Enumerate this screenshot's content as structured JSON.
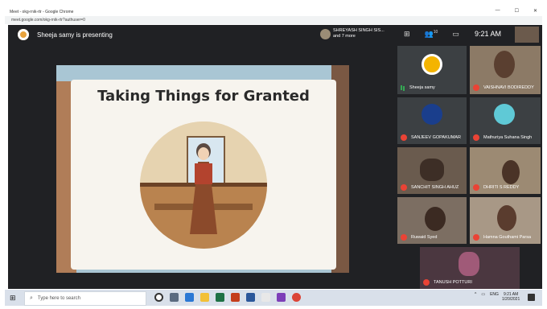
{
  "browser": {
    "title": "Meet - okg-rnik-rtr - Google Chrome",
    "url": "meet.google.com/okg-rnik-rtr?authuser=0",
    "controls": [
      "—",
      "☐",
      "✕"
    ]
  },
  "meet": {
    "presenter_text": "Sheeja samy is presenting",
    "shreyash_line1": "SHREYASH SINGH SIS...",
    "shreyash_line2": "and 7 more",
    "clock": "9:21 AM",
    "participants_count": "10",
    "icons": [
      "layout-icon",
      "people-icon",
      "chat-icon"
    ]
  },
  "slide": {
    "title": "Taking Things for Granted"
  },
  "participants": [
    {
      "name": "Sheeja samy",
      "muted": false
    },
    {
      "name": "VAISHNAVI BODIREDDY",
      "muted": true
    },
    {
      "name": "SANJEEV GOPAKUMAR",
      "muted": true
    },
    {
      "name": "Mathuriya Suhana Singh",
      "muted": true
    },
    {
      "name": "SANCHIT SINGH AHUZ",
      "muted": true
    },
    {
      "name": "DHRITI S REDDY",
      "muted": true
    },
    {
      "name": "Ruwaid Syed",
      "muted": true
    },
    {
      "name": "Hamna Gouthami Parsa",
      "muted": true
    },
    {
      "name": "TANUSH POTTURI",
      "muted": true
    }
  ],
  "taskbar": {
    "search_placeholder": "Type here to search",
    "time": "9:21 AM",
    "date": "1/20/2021",
    "lang": "ENG"
  }
}
